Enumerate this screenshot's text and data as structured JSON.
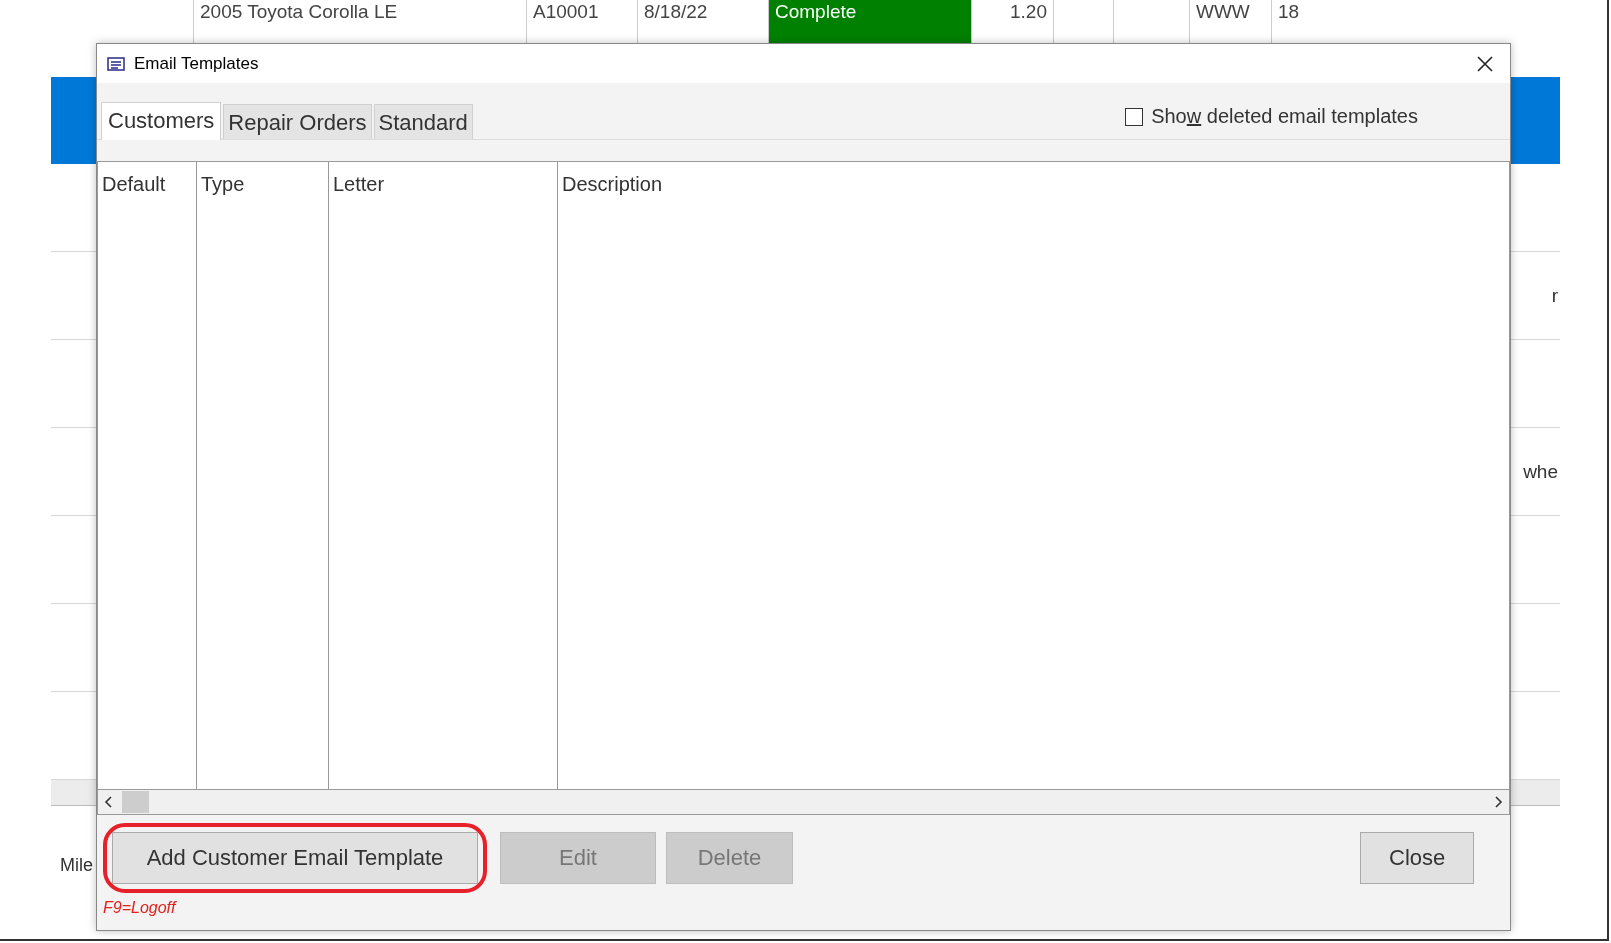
{
  "background": {
    "top_row": [
      {
        "text": "2005 Toyota Corolla LE",
        "kind": "text"
      },
      {
        "text": "A10001",
        "kind": "text"
      },
      {
        "text": "8/18/22",
        "kind": "text"
      },
      {
        "text": "Complete",
        "kind": "status",
        "color": "#008000"
      },
      {
        "text": "1.20",
        "kind": "number"
      },
      {
        "kind": "empty"
      },
      {
        "kind": "empty"
      },
      {
        "text": "WWW",
        "kind": "text"
      },
      {
        "text": "18",
        "kind": "text"
      }
    ],
    "right_fragments": [
      "r",
      "whe"
    ],
    "footer_label": "Mile"
  },
  "dialog": {
    "title": "Email Templates",
    "tabs": [
      {
        "label": "Customers",
        "selected": true
      },
      {
        "label": "Repair Orders",
        "selected": false
      },
      {
        "label": "Standard",
        "selected": false
      }
    ],
    "show_deleted": {
      "label_before_key": "Sho",
      "access_key": "w",
      "label_after_key": " deleted email templates",
      "checked": false
    },
    "table": {
      "columns": [
        "Default",
        "Type",
        "Letter",
        "Description"
      ]
    },
    "buttons": [
      {
        "label": "Add Customer Email Template",
        "disabled": false,
        "highlighted": true
      },
      {
        "label": "Edit",
        "disabled": true,
        "highlighted": false
      },
      {
        "label": "Delete",
        "disabled": true,
        "highlighted": false
      },
      {
        "label": "Close",
        "disabled": false,
        "highlighted": false
      }
    ],
    "hint": "F9=Logoff"
  }
}
